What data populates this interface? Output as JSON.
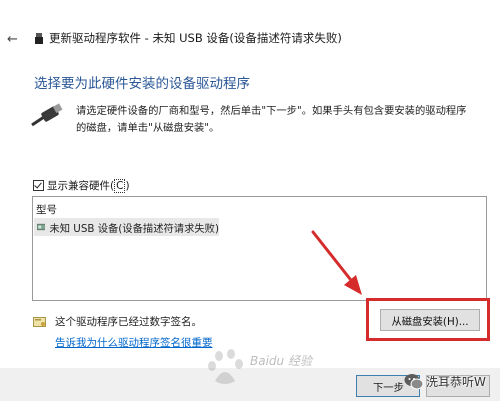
{
  "window": {
    "title": "更新驱动程序软件 - 未知 USB 设备(设备描述符请求失败)",
    "back_icon": "back-arrow-icon"
  },
  "page": {
    "heading": "选择要为此硬件安装的设备驱动程序",
    "instruction": "请选定硬件设备的厂商和型号，然后单击\"下一步\"。如果手头有包含要安装的驱动程序的磁盘，请单击\"从磁盘安装\"。"
  },
  "compat": {
    "checked": true,
    "label": "显示兼容硬件(",
    "accel": "C",
    "label_end": ")"
  },
  "list": {
    "column_header": "型号",
    "items": [
      "未知 USB 设备(设备描述符请求失败)"
    ]
  },
  "signature": {
    "text": "这个驱动程序已经过数字签名。",
    "link": "告诉我为什么驱动程序签名很重要"
  },
  "buttons": {
    "have_disk": "从磁盘安装(H)...",
    "next": "下一步"
  },
  "overlays": {
    "watermark": "Baidu 经验",
    "wechat_label": "洗耳恭听W",
    "annotation_color": "#d62b2b"
  }
}
